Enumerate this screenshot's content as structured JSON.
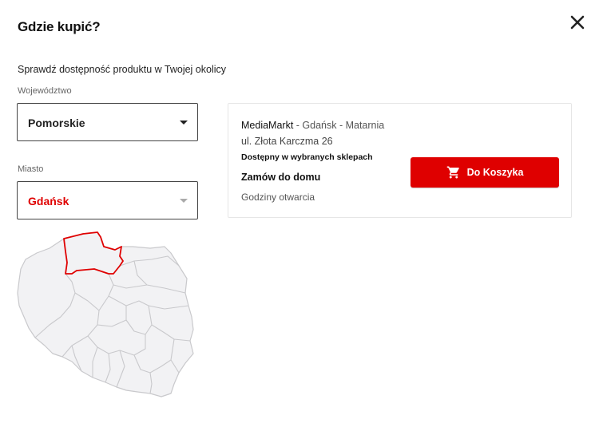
{
  "modal": {
    "title": "Gdzie kupić?",
    "close_icon": "close-icon",
    "subtitle": "Sprawdź dostępność produktu w Twojej okolicy"
  },
  "filters": {
    "voivodeship_label": "Województwo",
    "voivodeship_value": "Pomorskie",
    "city_label": "Miasto",
    "city_value": "Gdańsk"
  },
  "map": {
    "highlighted_region": "Pomorskie",
    "highlight_color": "#df0000",
    "fill_color": "#f2f2f4",
    "border_color": "#c9c9cc"
  },
  "store": {
    "brand": "MediaMarkt",
    "location": " - Gdańsk - Matarnia",
    "address": "ul. Złota Karczma 26",
    "availability": "Dostępny w wybranych sklepach",
    "delivery": "Zamów do domu",
    "hours_link": "Godziny otwarcia",
    "cart_button": "Do Koszyka",
    "cart_icon": "cart-icon"
  },
  "colors": {
    "accent": "#df0000",
    "text": "#1f1f1f",
    "muted": "#666666"
  }
}
